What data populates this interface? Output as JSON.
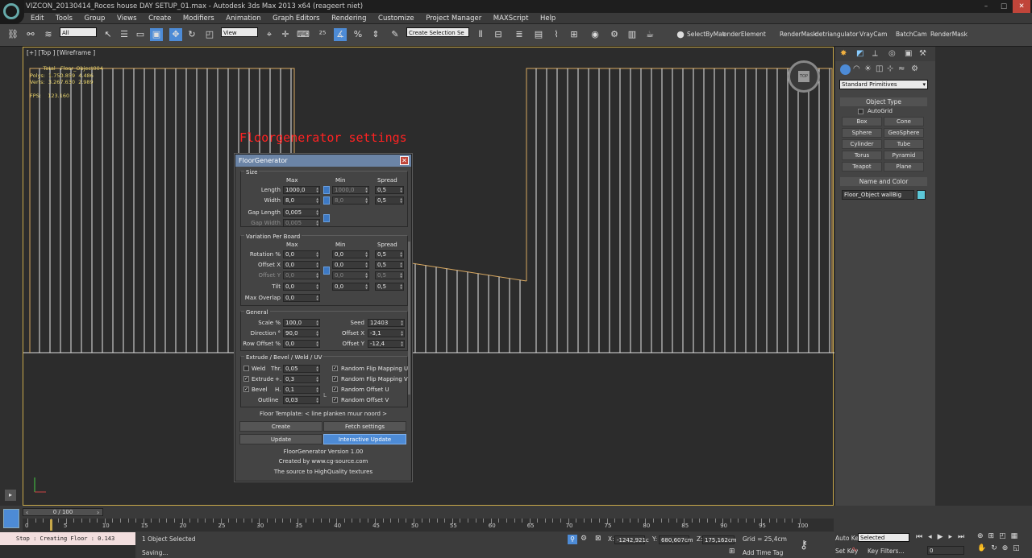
{
  "window": {
    "title": "VIZCON_20130414_Roces house DAY SETUP_01.max - Autodesk 3ds Max  2013 x64   (reageert niet)",
    "controls": [
      "–",
      "□",
      "✕"
    ]
  },
  "menu": [
    "Edit",
    "Tools",
    "Group",
    "Views",
    "Create",
    "Modifiers",
    "Animation",
    "Graph Editors",
    "Rendering",
    "Customize",
    "Project Manager",
    "MAXScript",
    "Help"
  ],
  "toolbar": {
    "selection_filter": "All",
    "ref_coord": "View",
    "named_selection": "Create Selection Se",
    "scripts": [
      "SelectByMat",
      "enderElement",
      "RenderMask",
      "detriangulator",
      "VrayCam",
      "BatchCam",
      "RenderMask"
    ]
  },
  "viewport": {
    "label": "[+] [Top ] [Wireframe ]",
    "stats": "        Total   Floor_Object004\nPolys:  1.750.859  4.486\nVerts:  3.267.630  2.989\n\nFPS:    123.160",
    "annotation": "Floorgenerator settings",
    "navcube_label": "TOP"
  },
  "command_panel": {
    "dropdown": "Standard Primitives",
    "object_type_header": "Object Type",
    "autogrid": "AutoGrid",
    "buttons": [
      "Box",
      "Cone",
      "Sphere",
      "GeoSphere",
      "Cylinder",
      "Tube",
      "Torus",
      "Pyramid",
      "Teapot",
      "Plane"
    ],
    "name_color_header": "Name and Color",
    "object_name": "Floor_Object wallBig",
    "object_color": "#5cc8d8"
  },
  "dialog": {
    "title": "FloorGenerator",
    "size": {
      "header": "Size",
      "cols": [
        "Max",
        "Min",
        "Spread"
      ],
      "rows": [
        {
          "label": "Length",
          "max": "1000,0",
          "min": "1000,0",
          "spread": "0,5"
        },
        {
          "label": "Width",
          "max": "8,0",
          "min": "8,0",
          "spread": "0,5"
        },
        {
          "label": "Gap Length",
          "max": "0,005"
        },
        {
          "label": "Gap Width",
          "max": "0,005"
        }
      ]
    },
    "variation": {
      "header": "Variation Per Board",
      "cols": [
        "Max",
        "Min",
        "Spread"
      ],
      "rows": [
        {
          "label": "Rotation %",
          "max": "0,0",
          "min": "0,0",
          "spread": "0,5"
        },
        {
          "label": "Offset X",
          "max": "0,0",
          "min": "0,0",
          "spread": "0,5"
        },
        {
          "label": "Offset Y",
          "max": "0,0",
          "min": "0,0",
          "spread": "0,5"
        },
        {
          "label": "Tilt",
          "max": "0,0",
          "min": "0,0",
          "spread": "0,5"
        },
        {
          "label": "Max Overlap",
          "max": "0,0"
        }
      ]
    },
    "general": {
      "header": "General",
      "scale_label": "Scale %",
      "scale": "100,0",
      "direction_label": "Direction °",
      "direction": "90,0",
      "row_offset_label": "Row Offset %",
      "row_offset": "0,0",
      "seed_label": "Seed",
      "seed": "12403",
      "offx_label": "Offset X",
      "offx": "-3,1",
      "offy_label": "Offset Y",
      "offy": "-12,4"
    },
    "extrude": {
      "header": "Extrude / Bevel / Weld / UV",
      "weld": "Weld",
      "weld_thr_label": "Thr.",
      "weld_thr": "0,05",
      "extrude": "Extrude",
      "extrude_h_label": "+.",
      "extrude_h": "0,3",
      "bevel": "Bevel",
      "bevel_h_label": "H.",
      "bevel_h": "0,1",
      "outline": "Outline",
      "outline_val": "0,03",
      "flipu": "Random Flip Mapping U",
      "flipv": "Random Flip Mapping V",
      "offu": "Random Offset U",
      "offv": "Random Offset V"
    },
    "template": "Floor Template: < line planken muur noord >",
    "create": "Create",
    "fetch": "Fetch settings",
    "update": "Update",
    "interactive": "Interactive Update",
    "version": "FloorGenerator Version 1.00",
    "created_by": "Created by www.cg-source.com",
    "source": "The source to HighQuality textures"
  },
  "timeline": {
    "slider": "0 / 100",
    "ticks": [
      "0",
      "5",
      "10",
      "15",
      "20",
      "25",
      "30",
      "35",
      "40",
      "45",
      "50",
      "55",
      "60",
      "65",
      "70",
      "75",
      "80",
      "85",
      "90",
      "95",
      "100"
    ]
  },
  "status": {
    "maxscript": "Stop  : Creating Floor : 0.143",
    "selected": "1 Object Selected",
    "prompt": "Saving...",
    "x": "-1242,921c",
    "y": "680,607cm",
    "z": "175,162cm",
    "grid": "Grid = 25,4cm",
    "add_time_tag": "Add Time Tag",
    "auto_key": "Auto Key",
    "set_key": "Set Key",
    "key_mode": "Selected",
    "key_filters": "Key Filters...",
    "frame": "0"
  }
}
